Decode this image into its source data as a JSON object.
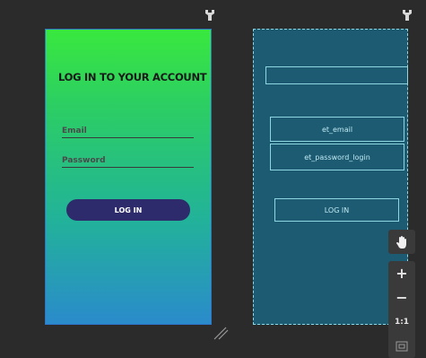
{
  "design_preview": {
    "title": "LOG IN TO YOUR ACCOUNT",
    "email_hint": "Email",
    "password_hint": "Password",
    "login_button": "LOG IN"
  },
  "blueprint": {
    "email_id": "et_email",
    "password_id": "et_password_login",
    "button_label": "LOG IN"
  },
  "zoom_controls": {
    "zoom_in": "+",
    "zoom_out": "−",
    "actual_size": "1:1"
  },
  "colors": {
    "canvas": "#2b2b2b",
    "gradient_top": "#39e83e",
    "gradient_bottom": "#2a8bcb",
    "button_bg": "#2d2b6b",
    "blueprint_bg": "#1d5b73",
    "blueprint_line": "#8fd6e3"
  },
  "icons": [
    "pin-icon",
    "resize-handle-icon",
    "pan-hand-icon",
    "fit-screen-icon"
  ]
}
